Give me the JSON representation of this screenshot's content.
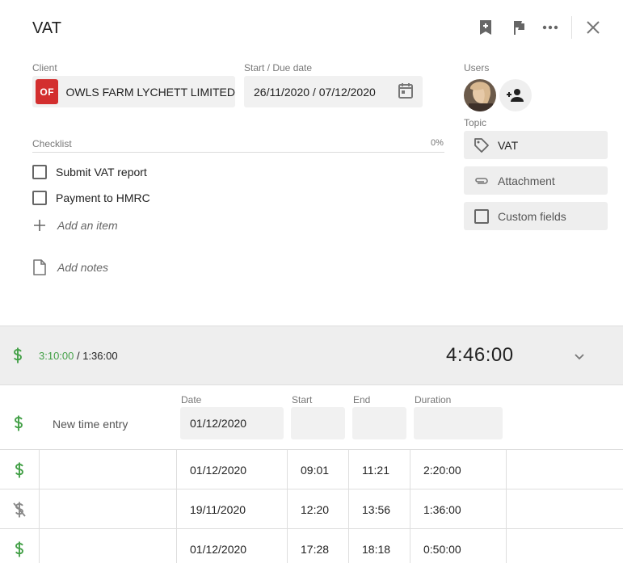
{
  "header": {
    "title": "VAT"
  },
  "client": {
    "label": "Client",
    "badge": "OF",
    "name": "OWLS FARM LYCHETT LIMITED"
  },
  "dates": {
    "label": "Start / Due date",
    "value": "26/11/2020 / 07/12/2020"
  },
  "users": {
    "label": "Users"
  },
  "checklist": {
    "label": "Checklist",
    "progress": "0%",
    "items": [
      {
        "label": "Submit VAT report",
        "checked": false
      },
      {
        "label": "Payment to HMRC",
        "checked": false
      }
    ],
    "add_item": "Add an item"
  },
  "notes": {
    "add_notes": "Add notes"
  },
  "topic": {
    "label": "Topic",
    "value": "VAT"
  },
  "side": {
    "attachment": "Attachment",
    "custom_fields": "Custom fields"
  },
  "timer": {
    "billable": "3:10:00",
    "separator": " / ",
    "non_billable": "1:36:00",
    "total": "4:46:00"
  },
  "entry": {
    "new_label": "New time entry",
    "date_label": "Date",
    "start_label": "Start",
    "end_label": "End",
    "duration_label": "Duration",
    "date_value": "01/12/2020"
  },
  "entries": [
    {
      "billable": true,
      "date": "01/12/2020",
      "start": "09:01",
      "end": "11:21",
      "duration": "2:20:00"
    },
    {
      "billable": false,
      "date": "19/11/2020",
      "start": "12:20",
      "end": "13:56",
      "duration": "1:36:00"
    },
    {
      "billable": true,
      "date": "01/12/2020",
      "start": "17:28",
      "end": "18:18",
      "duration": "0:50:00"
    }
  ],
  "colors": {
    "accent_green": "#43a047",
    "client_badge": "#d32f2f"
  }
}
